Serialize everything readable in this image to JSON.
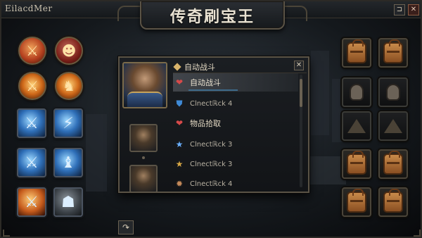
{
  "window": {
    "brand": "EilacdMer",
    "title": "传奇刷宝王",
    "minimize_glyph": "⊐",
    "close_glyph": "✕"
  },
  "left_skills": [
    {
      "name": "sword-strike-skill",
      "glyph": "⚔",
      "style": "red"
    },
    {
      "name": "bald-warrior-skill",
      "glyph": "☻",
      "style": "crim"
    },
    {
      "name": "fire-sword-skill",
      "glyph": "⚔",
      "style": "flame"
    },
    {
      "name": "fire-mage-skill",
      "glyph": "♞",
      "style": "flame"
    },
    {
      "name": "ice-blade-skill",
      "glyph": "⚔",
      "style": "ice"
    },
    {
      "name": "lightning-slash-skill",
      "glyph": "⚡",
      "style": "ice"
    },
    {
      "name": "frost-sword-skill",
      "glyph": "⚔",
      "style": "ice"
    },
    {
      "name": "ice-mage-skill",
      "glyph": "♝",
      "style": "ice"
    },
    {
      "name": "flame-blade-skill",
      "glyph": "⚔",
      "style": "ember"
    },
    {
      "name": "steel-helm-skill",
      "glyph": "☗",
      "style": "steel"
    }
  ],
  "panel": {
    "header": "自动战斗",
    "close_glyph": "✕",
    "rows": [
      {
        "label": "自动战斗",
        "icon": "heart-icon",
        "glyph": "❤",
        "kind": "active"
      },
      {
        "label": "Clnectℝck 4",
        "icon": "shield-icon",
        "glyph": "⛊",
        "kind": "item"
      },
      {
        "label": "物品拾取",
        "icon": "heart-icon",
        "glyph": "❤",
        "kind": "cat"
      },
      {
        "label": "Clnectℝck 3",
        "icon": "blue-star-icon",
        "glyph": "★",
        "kind": "item"
      },
      {
        "label": "Clnectℝck 3",
        "icon": "gold-star-icon",
        "glyph": "★",
        "kind": "item"
      },
      {
        "label": "Clnectℝck 4",
        "icon": "gear-icon",
        "glyph": "✹",
        "kind": "item"
      }
    ]
  },
  "back_glyph": "↷",
  "inventory": [
    {
      "name": "backpack",
      "type": "bag"
    },
    {
      "name": "backpack",
      "type": "bag"
    },
    {
      "name": "helmet-slot",
      "type": "head"
    },
    {
      "name": "helmet-slot",
      "type": "head"
    },
    {
      "name": "empty-slot",
      "type": "tri"
    },
    {
      "name": "empty-slot",
      "type": "tri"
    },
    {
      "name": "backpack",
      "type": "bag"
    },
    {
      "name": "backpack",
      "type": "bag"
    },
    {
      "name": "backpack",
      "type": "bag"
    },
    {
      "name": "backpack",
      "type": "bag"
    }
  ],
  "colors": {
    "accent": "#d8b36a",
    "frame": "#5a5346",
    "highlight_line": "#3d6a8a"
  }
}
